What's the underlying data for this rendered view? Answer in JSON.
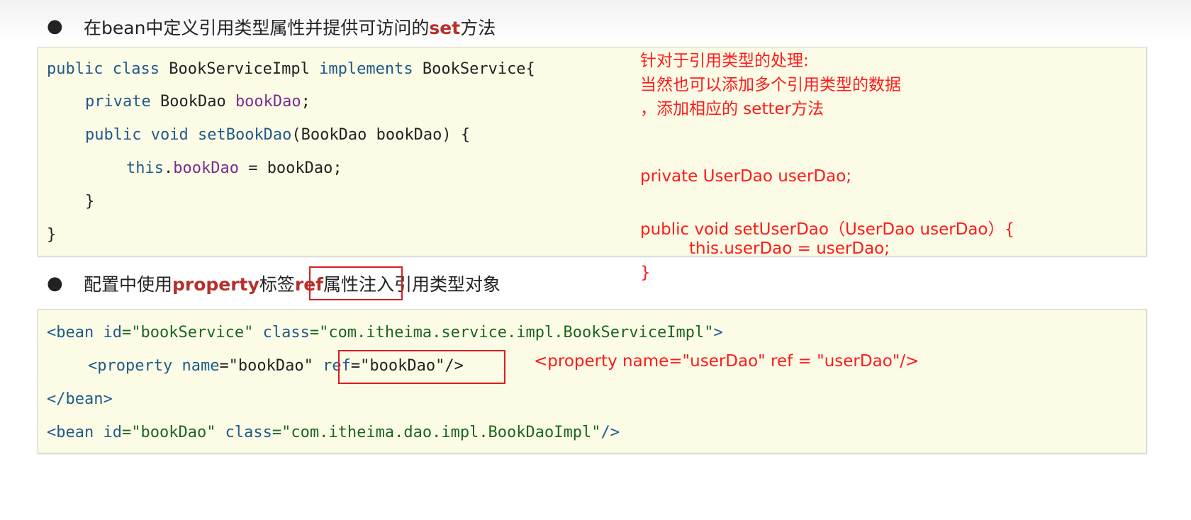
{
  "section1": {
    "bullet": "●",
    "heading_pre": "在bean中定义引用类型属性并提供可访问的",
    "heading_kw": "set",
    "heading_post": "方法"
  },
  "code1": {
    "l1_kw1": "public",
    "l1_kw2": "class",
    "l1_name": "BookServiceImpl",
    "l1_kw3": "implements",
    "l1_iface": "BookService{",
    "l2_kw": "private",
    "l2_type": "BookDao",
    "l2_field": "bookDao",
    "l2_end": ";",
    "l3_kw1": "public",
    "l3_kw2": "void",
    "l3_method": "setBookDao",
    "l3_params": "(BookDao bookDao) {",
    "l4_this": "this",
    "l4_dot": ".",
    "l4_field": "bookDao",
    "l4_rest": " = bookDao;",
    "l5": "}",
    "l6": "}"
  },
  "section2": {
    "bullet": "●",
    "heading_pre": "配置中使用",
    "heading_kw1": "property",
    "heading_mid": "标签",
    "heading_kw2": "ref",
    "heading_post": "属性注入引用类型对象"
  },
  "code2": {
    "l1_open": "<bean ",
    "l1_a1": "id",
    "l1_v1": "=\"bookService\"",
    "l1_a2": " class",
    "l1_v2": "=\"com.itheima.service.impl.BookServiceImpl\"",
    "l1_close": ">",
    "l2_open": "<property ",
    "l2_a1": "name",
    "l2_v1": "=\"bookDao\"",
    "l2_a2": "ref",
    "l2_v2": "=\"bookDao\"",
    "l2_close": "/>",
    "l3": "</bean>",
    "l4_open": "<bean ",
    "l4_a1": "id",
    "l4_v1": "=\"bookDao\"",
    "l4_a2": " class",
    "l4_v2": "=\"com.itheima.dao.impl.BookDaoImpl\"",
    "l4_close": "/>"
  },
  "notes": {
    "n1": "针对于引用类型的处理:",
    "n2": "当然也可以添加多个引用类型的数据",
    "n3": "，添加相应的 setter方法",
    "n4": "private UserDao userDao;",
    "n5": "public void setUserDao（UserDao userDao）{",
    "n6": "this.userDao = userDao;",
    "n7": "}",
    "n8": "<property name=\"userDao\" ref = \"userDao\"/>"
  },
  "colors": {
    "annotation": "#ff1a1a",
    "keyword": "#1f5a8a",
    "field": "#7b2d8e",
    "string": "#1a6620",
    "highlight": "#b5302a",
    "code_bg": "#fcfce6"
  }
}
